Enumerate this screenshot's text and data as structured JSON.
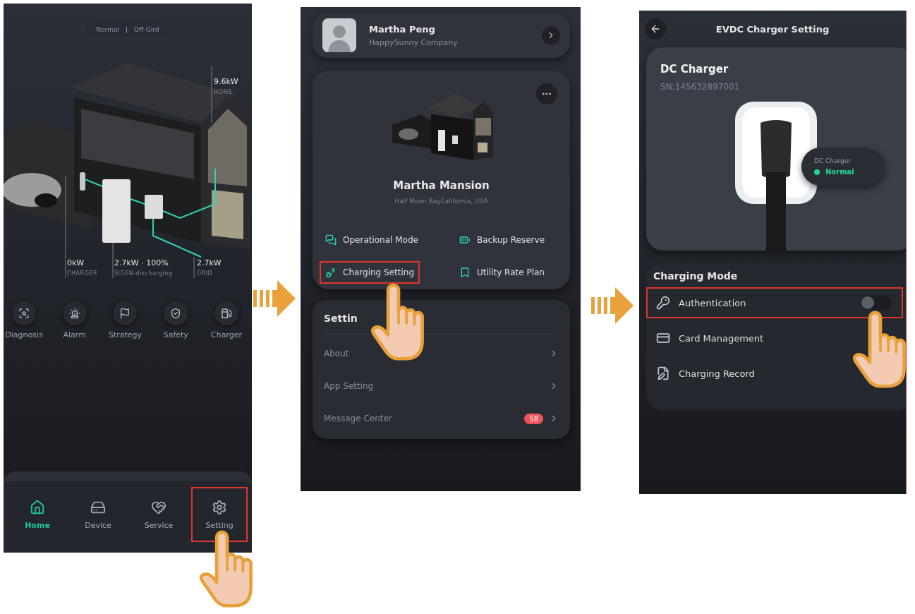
{
  "home_screen": {
    "status": {
      "mode": "Normal",
      "grid": "Off-Gird"
    },
    "readings": [
      {
        "value": "9.6kW",
        "label": "HOME"
      },
      {
        "value": "0kW",
        "label": "CHARGER"
      },
      {
        "value": "2.7kW · 100%",
        "label": "SIGEN-discharging"
      },
      {
        "value": "2.7kW",
        "label": "GRID"
      }
    ],
    "shortcuts": [
      {
        "label": "Diagnosis"
      },
      {
        "label": "Alarm"
      },
      {
        "label": "Strategy"
      },
      {
        "label": "Safety"
      },
      {
        "label": "Charger"
      }
    ],
    "nav": [
      {
        "label": "Home",
        "selected": true,
        "highlighted": false
      },
      {
        "label": "Device",
        "selected": false,
        "highlighted": false
      },
      {
        "label": "Service",
        "selected": false,
        "highlighted": false
      },
      {
        "label": "Setting",
        "selected": false,
        "highlighted": true
      }
    ]
  },
  "settings_screen": {
    "profile": {
      "name": "Martha Peng",
      "company": "HappySunny Company"
    },
    "site": {
      "name": "Martha Mansion",
      "address": "Half Moon BayCalifornia, USA"
    },
    "site_actions": [
      {
        "label": "Operational Mode",
        "highlighted": false
      },
      {
        "label": "Backup Reserve",
        "highlighted": false
      },
      {
        "label": "Charging Setting",
        "highlighted": true
      },
      {
        "label": "Utility Rate Plan",
        "highlighted": false
      }
    ],
    "section_title": "Settin",
    "settings_items": [
      {
        "label": "About"
      },
      {
        "label": "App Setting"
      },
      {
        "label": "Message Center",
        "badge": "58"
      }
    ]
  },
  "charger_screen": {
    "title": "EVDC Charger Setting",
    "device": {
      "name": "DC Charger",
      "serial": "SN:145632897001",
      "status_label": "DC Charger",
      "status": "Normal"
    },
    "section_title": "Charging Mode",
    "rows": [
      {
        "kind": "toggle",
        "label": "Authentication",
        "on": false,
        "highlighted": true
      },
      {
        "kind": "link",
        "label": "Card Management",
        "highlighted": false
      },
      {
        "kind": "link",
        "label": "Charging Record",
        "highlighted": false
      }
    ]
  }
}
